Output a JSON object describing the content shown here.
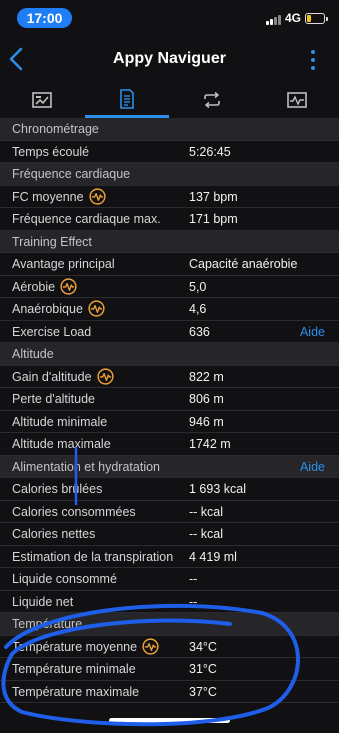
{
  "status": {
    "time": "17:00",
    "network": "4G"
  },
  "nav": {
    "title": "Appy Naviguer"
  },
  "tabs": [
    {
      "icon": "chart-icon"
    },
    {
      "icon": "document-icon"
    },
    {
      "icon": "repeat-icon"
    },
    {
      "icon": "pulse-icon"
    }
  ],
  "rows": [
    {
      "type": "section",
      "label": "Chronométrage"
    },
    {
      "type": "row",
      "label": "Temps écoulé",
      "value": "5:26:45"
    },
    {
      "type": "section",
      "label": "Fréquence cardiaque"
    },
    {
      "type": "row",
      "label": "FC moyenne",
      "value": "137 bpm",
      "icon": true
    },
    {
      "type": "row",
      "label": "Fréquence cardiaque max.",
      "value": "171 bpm"
    },
    {
      "type": "section",
      "label": "Training Effect"
    },
    {
      "type": "row",
      "label": "Avantage principal",
      "value": "Capacité anaérobie"
    },
    {
      "type": "row",
      "label": "Aérobie",
      "value": "5,0",
      "icon": true
    },
    {
      "type": "row",
      "label": "Anaérobique",
      "value": "4,6",
      "icon": true
    },
    {
      "type": "row",
      "label": "Exercise Load",
      "value": "636",
      "link": "Aide"
    },
    {
      "type": "section",
      "label": "Altitude"
    },
    {
      "type": "row",
      "label": "Gain d'altitude",
      "value": "822 m",
      "icon": true
    },
    {
      "type": "row",
      "label": "Perte d'altitude",
      "value": "806 m"
    },
    {
      "type": "row",
      "label": "Altitude minimale",
      "value": "946 m"
    },
    {
      "type": "row",
      "label": "Altitude maximale",
      "value": "1742 m"
    },
    {
      "type": "section",
      "label": "Alimentation et hydratation",
      "link": "Aide"
    },
    {
      "type": "row",
      "label": "Calories brûlées",
      "value": "1 693 kcal"
    },
    {
      "type": "row",
      "label": "Calories consommées",
      "value": "-- kcal"
    },
    {
      "type": "row",
      "label": "Calories nettes",
      "value": "-- kcal"
    },
    {
      "type": "row",
      "label": "Estimation de la transpiration",
      "value": "4 419 ml"
    },
    {
      "type": "row",
      "label": "Liquide consommé",
      "value": "--"
    },
    {
      "type": "row",
      "label": "Liquide net",
      "value": "--"
    },
    {
      "type": "section",
      "label": "Température"
    },
    {
      "type": "row",
      "label": "Température moyenne",
      "value": "34°C",
      "icon": true
    },
    {
      "type": "row",
      "label": "Température minimale",
      "value": "31°C"
    },
    {
      "type": "row",
      "label": "Température maximale",
      "value": "37°C"
    }
  ],
  "colors": {
    "accent": "#2a8fe8",
    "icon_orange": "#f0a23a",
    "section_bg": "#26262a",
    "background": "#111113"
  }
}
